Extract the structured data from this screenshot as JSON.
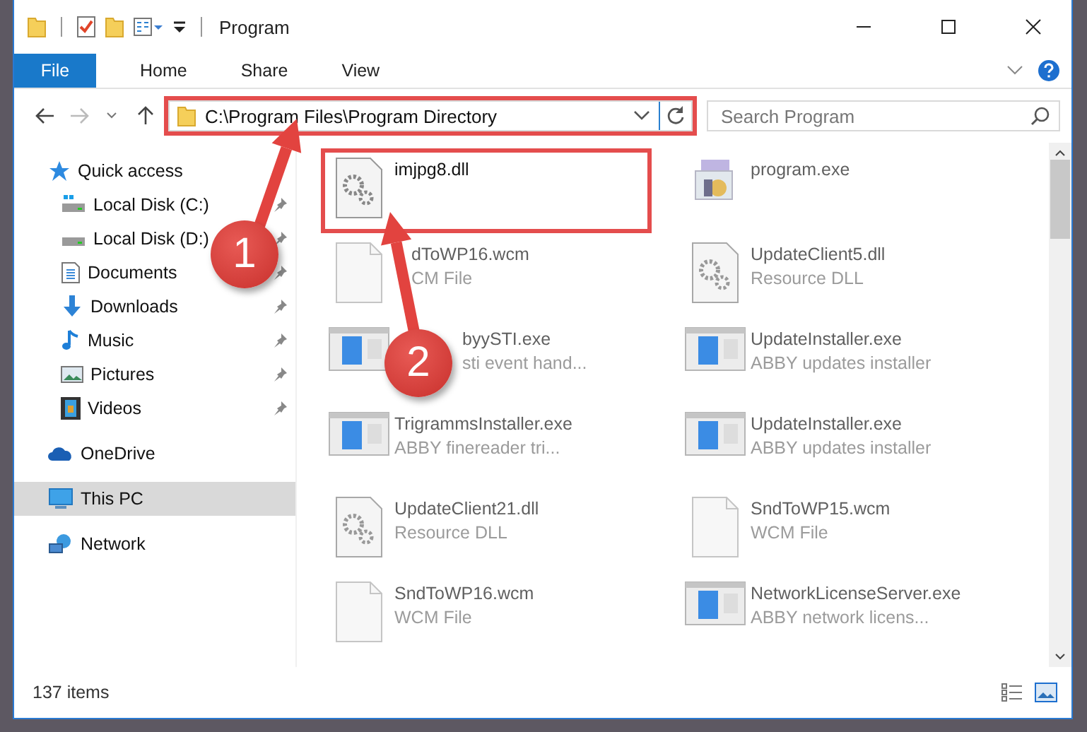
{
  "window": {
    "title": "Program"
  },
  "ribbon": {
    "tabs": [
      {
        "label": "File",
        "kind": "file",
        "selected": false
      },
      {
        "label": "Home",
        "kind": "tab",
        "selected": false
      },
      {
        "label": "Share",
        "kind": "tab",
        "selected": false
      },
      {
        "label": "View",
        "kind": "tab",
        "selected": false
      }
    ]
  },
  "address_bar": {
    "path": "C:\\Program Files\\Program Directory",
    "highlighted": true
  },
  "search": {
    "placeholder": "Search Program"
  },
  "navigation": {
    "items": [
      {
        "label": "Quick access",
        "kind": "star",
        "selected": false,
        "children": [
          {
            "label": "Local Disk (C:)",
            "kind": "system-drive",
            "pinned": true,
            "selected": false
          },
          {
            "label": "Local Disk (D:)",
            "kind": "drive",
            "pinned": true,
            "selected": false
          },
          {
            "label": "Documents",
            "kind": "documents",
            "pinned": true,
            "selected": false
          },
          {
            "label": "Downloads",
            "kind": "downloads",
            "pinned": true,
            "selected": false
          },
          {
            "label": "Music",
            "kind": "music",
            "pinned": true,
            "selected": false
          },
          {
            "label": "Pictures",
            "kind": "pictures",
            "pinned": true,
            "selected": false
          },
          {
            "label": "Videos",
            "kind": "videos",
            "pinned": true,
            "selected": false
          }
        ]
      },
      {
        "label": "OneDrive",
        "kind": "cloud",
        "selected": false
      },
      {
        "label": "This PC",
        "kind": "computer",
        "selected": true
      },
      {
        "label": "Network",
        "kind": "network",
        "selected": false
      }
    ]
  },
  "files": [
    {
      "name": "imjpg8.dll",
      "kind": "dll",
      "blurred": false,
      "highlighted": true
    },
    {
      "name": "program.exe",
      "kind": "program",
      "blurred": true,
      "highlighted": false
    },
    {
      "name": "dToWP16.wcm",
      "description": "CM File",
      "kind": "document",
      "blurred": true,
      "highlighted": false
    },
    {
      "name": "UpdateClient5.dll",
      "description": "Resource DLL",
      "kind": "dll",
      "blurred": true,
      "highlighted": false
    },
    {
      "name": "byySTI.exe",
      "description": "sti event hand...",
      "kind": "app",
      "blurred": true,
      "highlighted": false
    },
    {
      "name": "UpdateInstaller.exe",
      "description": "ABBY updates installer",
      "kind": "app",
      "blurred": true,
      "highlighted": false
    },
    {
      "name": "TrigrammsInstaller.exe",
      "description": "ABBY finereader tri...",
      "kind": "app",
      "blurred": true,
      "highlighted": false
    },
    {
      "name": "UpdateInstaller.exe",
      "description": "ABBY updates installer",
      "kind": "app",
      "blurred": true,
      "highlighted": false
    },
    {
      "name": "UpdateClient21.dll",
      "description": "Resource DLL",
      "kind": "dll",
      "blurred": true,
      "highlighted": false
    },
    {
      "name": "SndToWP15.wcm",
      "description": "WCM File",
      "kind": "document",
      "blurred": true,
      "highlighted": false
    },
    {
      "name": "SndToWP16.wcm",
      "description": "WCM File",
      "kind": "document",
      "blurred": true,
      "highlighted": false
    },
    {
      "name": "NetworkLicenseServer.exe",
      "description": "ABBY network licens...",
      "kind": "app",
      "blurred": true,
      "highlighted": false
    }
  ],
  "annotations": [
    {
      "label": "1"
    },
    {
      "label": "2"
    }
  ],
  "status_bar": {
    "count": "137 items"
  }
}
